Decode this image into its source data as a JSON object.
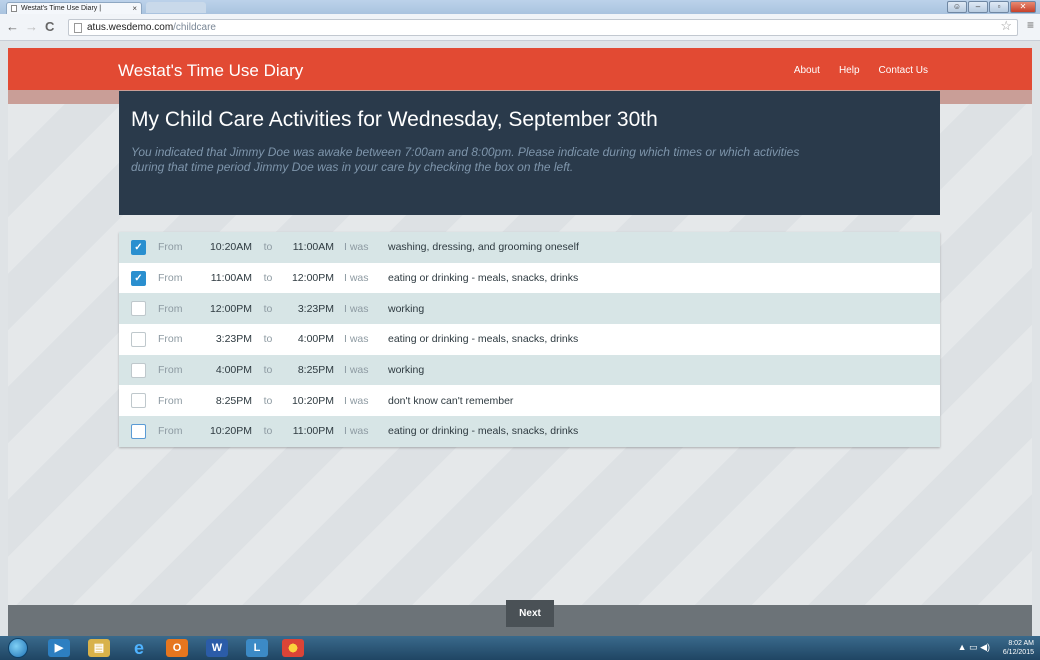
{
  "browser": {
    "tab_title": "Westat's Time Use Diary |",
    "tab_close": "×",
    "url_host": "atus.wesdemo.com",
    "url_path": "/childcare"
  },
  "header": {
    "app_title": "Westat's Time Use Diary",
    "nav": [
      "About",
      "Help",
      "Contact Us"
    ],
    "accent_color": "#e24a33"
  },
  "panel": {
    "title": "My Child Care Activities for Wednesday, September 30th",
    "description": "You indicated that Jimmy Doe was awake between 7:00am and 8:00pm. Please indicate during which times or which activities during that time period Jimmy Doe was in your care by checking the box on the left."
  },
  "labels": {
    "from": "From",
    "to": "to",
    "i_was": "I was"
  },
  "activities": [
    {
      "start": "10:20AM",
      "end": "11:00AM",
      "activity": "washing, dressing, and grooming oneself",
      "checked": true
    },
    {
      "start": "11:00AM",
      "end": "12:00PM",
      "activity": "eating or drinking - meals, snacks, drinks",
      "checked": true
    },
    {
      "start": "12:00PM",
      "end": "3:23PM",
      "activity": "working",
      "checked": false
    },
    {
      "start": "3:23PM",
      "end": "4:00PM",
      "activity": "eating or drinking - meals, snacks, drinks",
      "checked": false
    },
    {
      "start": "4:00PM",
      "end": "8:25PM",
      "activity": "working",
      "checked": false
    },
    {
      "start": "8:25PM",
      "end": "10:20PM",
      "activity": "don't know can't remember",
      "checked": false
    },
    {
      "start": "10:20PM",
      "end": "11:00PM",
      "activity": "eating or drinking - meals, snacks, drinks",
      "checked": false
    }
  ],
  "footer": {
    "next_label": "Next"
  },
  "taskbar": {
    "time": "8:02 AM",
    "date": "6/12/2015"
  }
}
